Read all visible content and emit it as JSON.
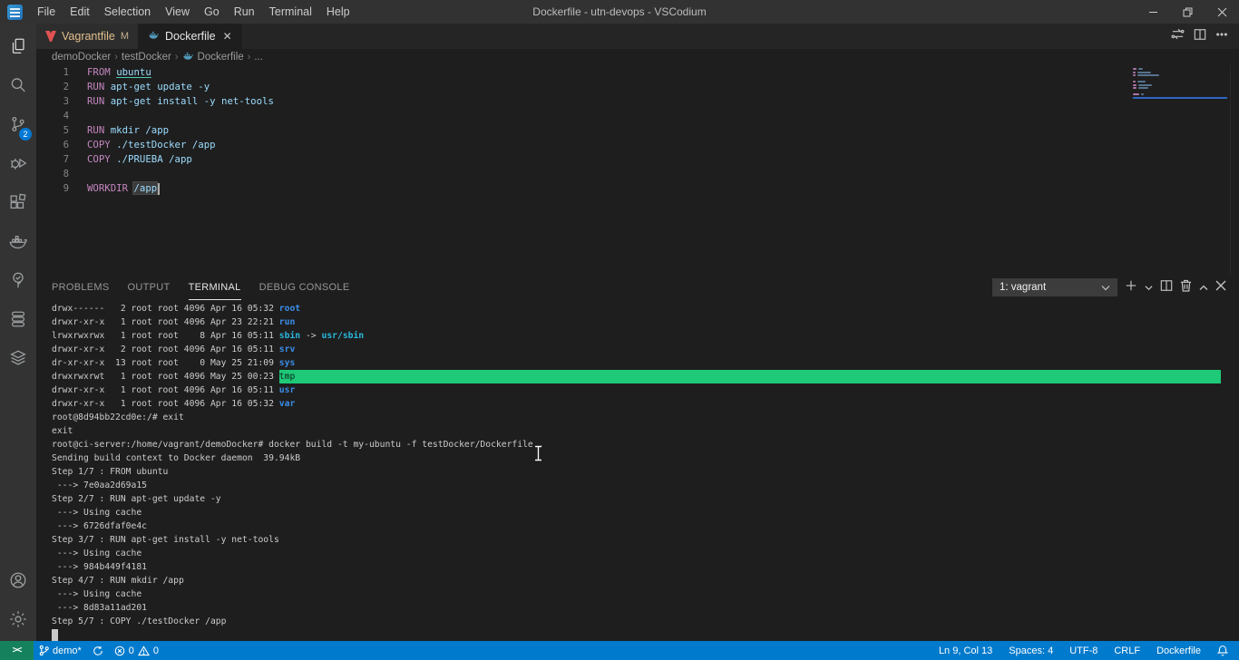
{
  "window": {
    "title": "Dockerfile - utn-devops - VSCodium"
  },
  "menu_bar": {
    "items": [
      "File",
      "Edit",
      "Selection",
      "View",
      "Go",
      "Run",
      "Terminal",
      "Help"
    ]
  },
  "activity_bar": {
    "top_icons": [
      "explorer",
      "search",
      "source-control",
      "run-and-debug",
      "extensions",
      "docker",
      "test-explorer",
      "database",
      "layers"
    ],
    "bottom_icons": [
      "account",
      "settings-gear"
    ],
    "scm_badge": "2"
  },
  "tab_bar": {
    "tabs": [
      {
        "label": "Vagrantfile",
        "icon": "vagrant",
        "badge": "M",
        "active": false
      },
      {
        "label": "Dockerfile",
        "icon": "docker-whale",
        "close": true,
        "active": true
      }
    ]
  },
  "breadcrumb": {
    "items": [
      {
        "label": "demoDocker"
      },
      {
        "label": "testDocker"
      },
      {
        "label": "Dockerfile",
        "icon": "docker-whale"
      },
      {
        "label": "..."
      }
    ]
  },
  "editor": {
    "language": "dockerfile",
    "lines": [
      {
        "num": "1",
        "tokens": [
          {
            "t": "FROM ",
            "c": "kw"
          },
          {
            "t": "ubuntu",
            "c": "arg link"
          }
        ]
      },
      {
        "num": "2",
        "tokens": [
          {
            "t": "RUN ",
            "c": "kw"
          },
          {
            "t": "apt-get update -y",
            "c": "arg"
          }
        ]
      },
      {
        "num": "3",
        "tokens": [
          {
            "t": "RUN ",
            "c": "kw"
          },
          {
            "t": "apt-get install -y net-tools",
            "c": "arg"
          }
        ]
      },
      {
        "num": "4",
        "tokens": []
      },
      {
        "num": "5",
        "tokens": [
          {
            "t": "RUN ",
            "c": "kw"
          },
          {
            "t": "mkdir /app",
            "c": "arg"
          }
        ]
      },
      {
        "num": "6",
        "tokens": [
          {
            "t": "COPY ",
            "c": "kw"
          },
          {
            "t": "./testDocker /app",
            "c": "arg"
          }
        ]
      },
      {
        "num": "7",
        "tokens": [
          {
            "t": "COPY ",
            "c": "kw"
          },
          {
            "t": "./PRUEBA /app",
            "c": "arg"
          }
        ]
      },
      {
        "num": "8",
        "tokens": []
      },
      {
        "num": "9",
        "tokens": [
          {
            "t": "WORKDIR ",
            "c": "kw"
          },
          {
            "t": "/app",
            "c": "arg hl"
          },
          {
            "t": "",
            "c": "caret"
          }
        ]
      }
    ]
  },
  "panel": {
    "tabs": [
      {
        "label": "PROBLEMS",
        "active": false
      },
      {
        "label": "OUTPUT",
        "active": false
      },
      {
        "label": "TERMINAL",
        "active": true
      },
      {
        "label": "DEBUG CONSOLE",
        "active": false
      }
    ],
    "terminal_dropdown_value": "1: vagrant"
  },
  "terminal": {
    "lines": [
      {
        "segs": [
          {
            "t": "drwx------   2 root root 4096 Apr 16 05:32 ",
            "c": ""
          },
          {
            "t": "root",
            "c": "dir"
          }
        ]
      },
      {
        "segs": [
          {
            "t": "drwxr-xr-x   1 root root 4096 Apr 23 22:21 ",
            "c": ""
          },
          {
            "t": "run",
            "c": "dir"
          }
        ]
      },
      {
        "segs": [
          {
            "t": "lrwxrwxrwx   1 root root    8 Apr 16 05:11 ",
            "c": ""
          },
          {
            "t": "sbin",
            "c": "sym"
          },
          {
            "t": " -> ",
            "c": ""
          },
          {
            "t": "usr/sbin",
            "c": "sym"
          }
        ]
      },
      {
        "segs": [
          {
            "t": "drwxr-xr-x   2 root root 4096 Apr 16 05:11 ",
            "c": ""
          },
          {
            "t": "srv",
            "c": "dir"
          }
        ]
      },
      {
        "segs": [
          {
            "t": "dr-xr-xr-x  13 root root    0 May 25 21:09 ",
            "c": ""
          },
          {
            "t": "sys",
            "c": "dir"
          }
        ]
      },
      {
        "segs": [
          {
            "t": "drwxrwxrwt   1 root root 4096 May 25 00:23 ",
            "c": ""
          },
          {
            "t": "tmp",
            "c": "tmp"
          }
        ],
        "fill": true
      },
      {
        "segs": [
          {
            "t": "drwxr-xr-x   1 root root 4096 Apr 16 05:11 ",
            "c": ""
          },
          {
            "t": "usr",
            "c": "dir"
          }
        ]
      },
      {
        "segs": [
          {
            "t": "drwxr-xr-x   1 root root 4096 Apr 16 05:32 ",
            "c": ""
          },
          {
            "t": "var",
            "c": "dir"
          }
        ]
      },
      {
        "segs": [
          {
            "t": "root@8d94bb22cd0e:/# exit",
            "c": ""
          }
        ]
      },
      {
        "segs": [
          {
            "t": "exit",
            "c": ""
          }
        ]
      },
      {
        "segs": [
          {
            "t": "root@ci-server:/home/vagrant/demoDocker# docker build -t my-ubuntu -f testDocker/Dockerfile .",
            "c": ""
          }
        ]
      },
      {
        "segs": [
          {
            "t": "Sending build context to Docker daemon  39.94kB",
            "c": ""
          }
        ]
      },
      {
        "segs": [
          {
            "t": "Step 1/7 : FROM ubuntu",
            "c": ""
          }
        ]
      },
      {
        "segs": [
          {
            "t": " ---> 7e0aa2d69a15",
            "c": ""
          }
        ]
      },
      {
        "segs": [
          {
            "t": "Step 2/7 : RUN apt-get update -y",
            "c": ""
          }
        ]
      },
      {
        "segs": [
          {
            "t": " ---> Using cache",
            "c": ""
          }
        ]
      },
      {
        "segs": [
          {
            "t": " ---> 6726dfaf0e4c",
            "c": ""
          }
        ]
      },
      {
        "segs": [
          {
            "t": "Step 3/7 : RUN apt-get install -y net-tools",
            "c": ""
          }
        ]
      },
      {
        "segs": [
          {
            "t": " ---> Using cache",
            "c": ""
          }
        ]
      },
      {
        "segs": [
          {
            "t": " ---> 984b449f4181",
            "c": ""
          }
        ]
      },
      {
        "segs": [
          {
            "t": "Step 4/7 : RUN mkdir /app",
            "c": ""
          }
        ]
      },
      {
        "segs": [
          {
            "t": " ---> Using cache",
            "c": ""
          }
        ]
      },
      {
        "segs": [
          {
            "t": " ---> 8d83a11ad201",
            "c": ""
          }
        ]
      },
      {
        "segs": [
          {
            "t": "Step 5/7 : COPY ./testDocker /app",
            "c": ""
          }
        ]
      },
      {
        "segs": [],
        "cursor": true
      }
    ]
  },
  "status_bar": {
    "branch_label": "demo*",
    "errors": "0",
    "warnings": "0",
    "right_items": [
      "Ln 9, Col 13",
      "Spaces: 4",
      "UTF-8",
      "CRLF",
      "Dockerfile"
    ]
  },
  "colors": {
    "status_bar": "#007acc",
    "remote_indicator": "#16825d",
    "keyword": "#c586c0",
    "argument": "#9cdcfe",
    "terminal_dir_blue": "#3b8eea",
    "terminal_green": "#1ec978",
    "modified_tab_label": "#e2c08d",
    "scm_badge": "#0078d4"
  }
}
